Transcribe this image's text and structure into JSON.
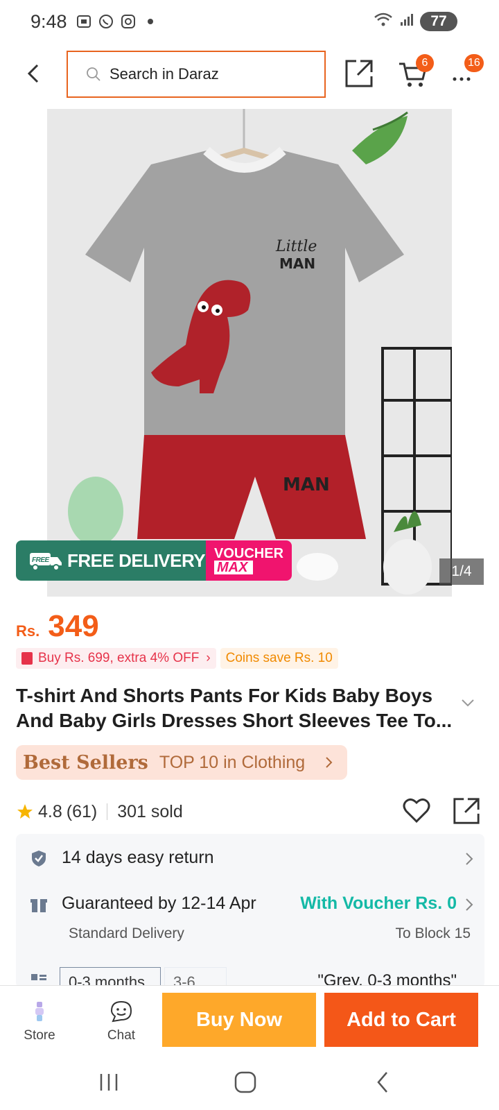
{
  "status_bar": {
    "time": "9:48",
    "battery": "77"
  },
  "header": {
    "search_placeholder": "Search in Daraz",
    "cart_badge": "6",
    "more_badge": "16"
  },
  "gallery": {
    "counter": "1/4",
    "free_delivery_tag": "FREE",
    "free_delivery": "FREE DELIVERY",
    "voucher_line1": "VOUCHER",
    "voucher_line2": "MAX"
  },
  "price": {
    "currency": "Rs.",
    "value": "349"
  },
  "promos": {
    "bundle": "Buy Rs. 699, extra 4% OFF",
    "coins": "Coins save Rs. 10"
  },
  "product": {
    "title": "T-shirt And Shorts Pants For Kids Baby Boys And Baby Girls Dresses Short Sleeves Tee To..."
  },
  "best_sellers": {
    "label": "Best Sellers",
    "text": "TOP 10 in Clothing"
  },
  "rating": {
    "score": "4.8",
    "count": "(61)",
    "sold": "301 sold"
  },
  "service": {
    "return": "14 days easy return",
    "delivery_title": "Guaranteed by 12-14 Apr",
    "delivery_sub": "Standard Delivery",
    "voucher": "With Voucher Rs. 0",
    "destination": "To Block 15",
    "variant1": "0-3 months",
    "variant2": "3-6 ...",
    "selected_variant": "\"Grey, 0-3 months\""
  },
  "bottom_bar": {
    "store": "Store",
    "chat": "Chat",
    "buy_now": "Buy Now",
    "add_to_cart": "Add to Cart"
  },
  "colors": {
    "accent_orange": "#f45718",
    "buy_now_yellow": "#fea82a",
    "voucher_teal": "#14b9a6",
    "free_delivery_green": "#2b7d66",
    "voucher_pink": "#f0146e"
  }
}
